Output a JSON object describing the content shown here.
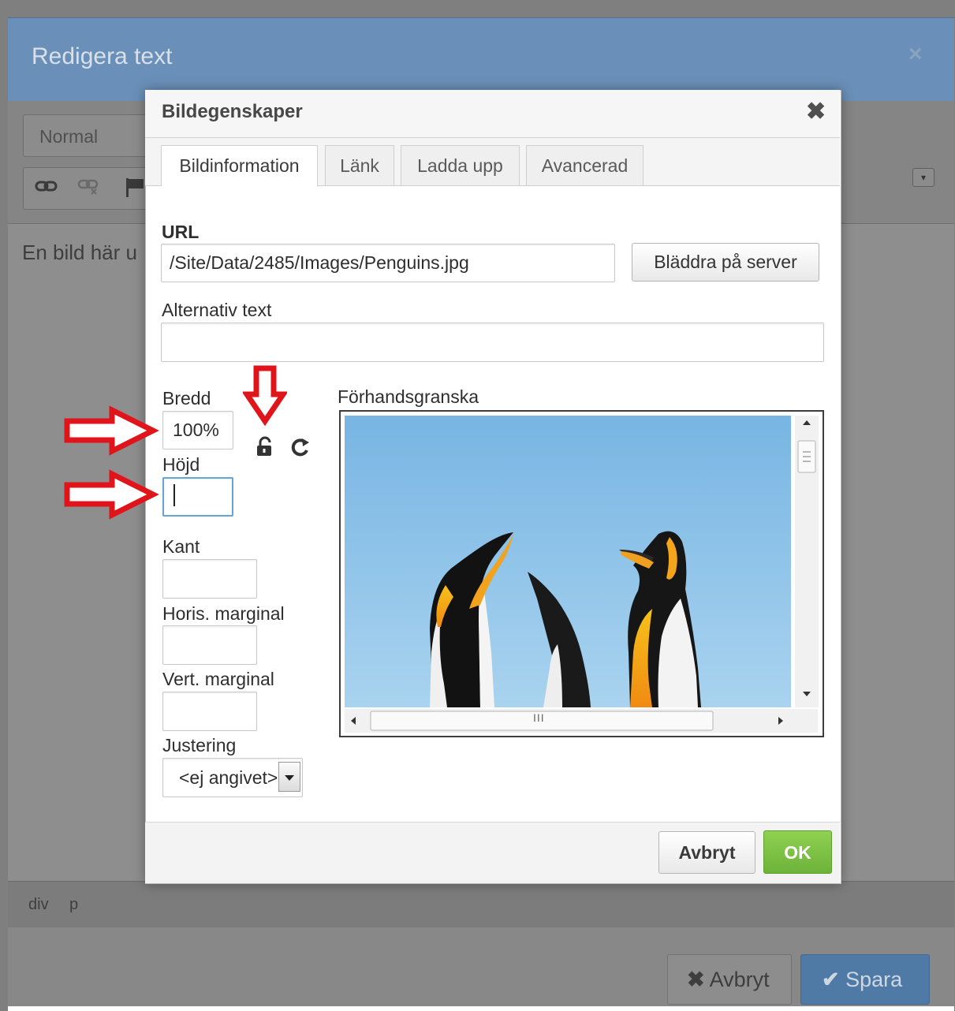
{
  "outer": {
    "title": "Redigera text",
    "close_symbol": "×",
    "format_value": "Normal",
    "editor_text": "En bild här u",
    "status_tags": [
      "div",
      "p"
    ],
    "cancel_label": "Avbryt",
    "save_label": "Spara",
    "cancel_icon": "✖",
    "save_icon": "✔"
  },
  "dialog": {
    "title": "Bildegenskaper",
    "close_symbol": "✖",
    "tabs": [
      {
        "label": "Bildinformation",
        "active": true
      },
      {
        "label": "Länk",
        "active": false
      },
      {
        "label": "Ladda upp",
        "active": false
      },
      {
        "label": "Avancerad",
        "active": false
      }
    ],
    "url_label": "URL",
    "url_value": "/Site/Data/2485/Images/Penguins.jpg",
    "browse_label": "Bläddra på server",
    "alt_label": "Alternativ text",
    "alt_value": "",
    "width_label": "Bredd",
    "width_value": "100%",
    "height_label": "Höjd",
    "height_value": "",
    "border_label": "Kant",
    "border_value": "",
    "hspace_label": "Horis. marginal",
    "hspace_value": "",
    "vspace_label": "Vert. marginal",
    "vspace_value": "",
    "align_label": "Justering",
    "align_value": "<ej angivet>",
    "preview_label": "Förhandsgranska",
    "scroll_grip": "III",
    "cancel_label": "Avbryt",
    "ok_label": "OK"
  },
  "colors": {
    "ok_green": "#7cc243",
    "annotation_red": "#e0141b",
    "outer_header_blue": "#6a8fb8",
    "sky_blue": "#8ec5ea"
  }
}
